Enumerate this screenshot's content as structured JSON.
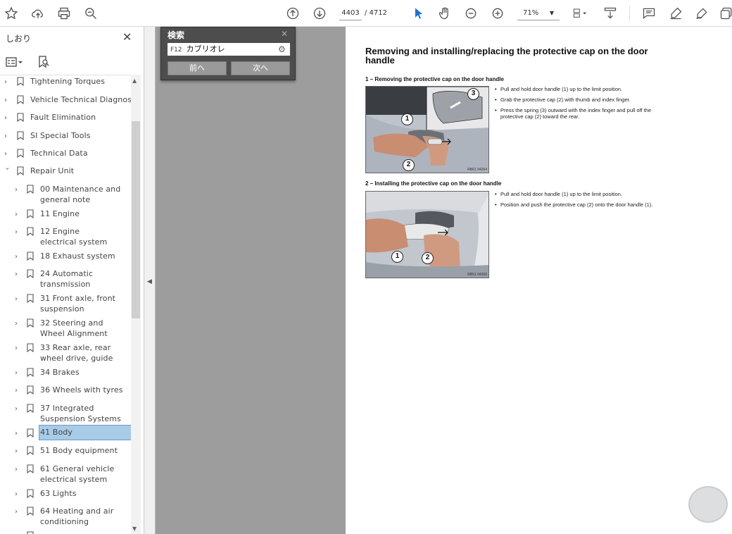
{
  "toolbar": {
    "page_current": "4403",
    "page_total": "/ 4712",
    "zoom": "71%"
  },
  "sidebar": {
    "title": "しおり",
    "items": [
      {
        "label": "Tightening Torques"
      },
      {
        "label": "Vehicle Technical Diagnosis"
      },
      {
        "label": "Fault Elimination"
      },
      {
        "label": "SI Special Tools"
      },
      {
        "label": "Technical Data"
      },
      {
        "label": "Repair Unit"
      },
      {
        "label": "00 Maintenance and general note"
      },
      {
        "label": "11 Engine"
      },
      {
        "label": "12 Engine electrical system"
      },
      {
        "label": "18 Exhaust system"
      },
      {
        "label": "24 Automatic transmission"
      },
      {
        "label": "31 Front axle, front suspension"
      },
      {
        "label": "32 Steering and Wheel Alignment"
      },
      {
        "label": "33 Rear axle, rear wheel drive, guide"
      },
      {
        "label": "34 Brakes"
      },
      {
        "label": "36 Wheels with tyres"
      },
      {
        "label": "37 Integrated Suspension Systems"
      },
      {
        "label": "41 Body"
      },
      {
        "label": "51 Body equipment"
      },
      {
        "label": "61 General vehicle electrical system"
      },
      {
        "label": "63 Lights"
      },
      {
        "label": "64 Heating and air conditioning"
      }
    ]
  },
  "search": {
    "title": "検索",
    "prefix": "F12",
    "query": "カブリオレ",
    "prev_label": "前へ",
    "next_label": "次へ"
  },
  "document": {
    "title": "Removing and installing/replacing the protective cap on the door handle",
    "section1": {
      "heading": "1 – Removing the protective cap on the door handle",
      "bullets": [
        "Pull and hold door handle (1) up to the limit position.",
        "Grab the protective cap (2) with thumb and index finger.",
        "Press the spring (3) outward with the index finger and pull off the protective cap (2) toward the rear."
      ],
      "figure_code": "RB61 04264",
      "callouts": [
        "1",
        "2",
        "3"
      ]
    },
    "section2": {
      "heading": "2 – Installing the protective cap on the door handle",
      "bullets": [
        "Pull and hold door handle (1) up to the limit position.",
        "Position and push the protective cap (2) onto the door handle (1)."
      ],
      "figure_code": "RB51 04265",
      "callouts": [
        "1",
        "2"
      ]
    }
  },
  "colors": {
    "gray_pane": "#9d9d9d",
    "search_bg": "#4d4d4d",
    "selected_bookmark": "#a8cbe8",
    "toolbar_icon": "#505050",
    "accent_pointer": "#1f6fd1"
  }
}
